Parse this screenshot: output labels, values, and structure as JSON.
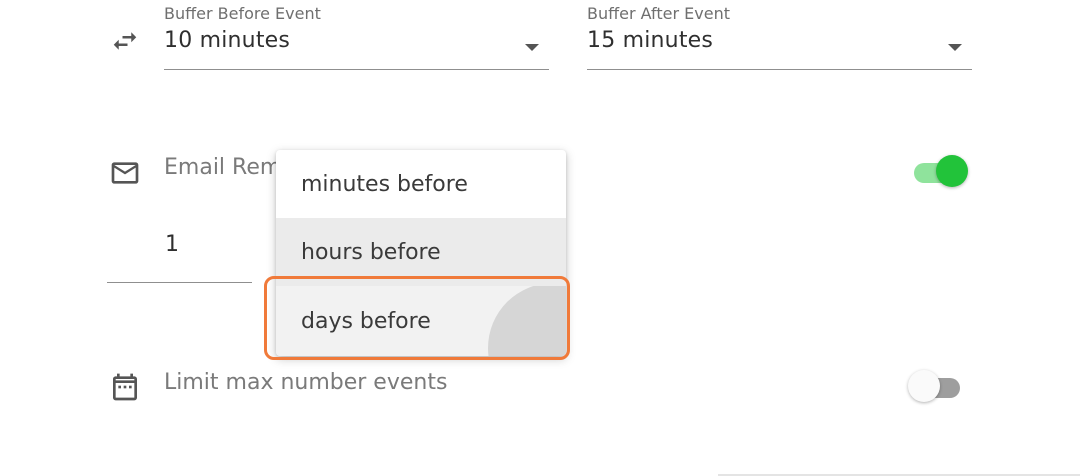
{
  "buffer": {
    "icon": "swap-horiz-icon",
    "before": {
      "label": "Buffer Before Event",
      "value": "10 minutes"
    },
    "after": {
      "label": "Buffer After Event",
      "value": "15 minutes"
    }
  },
  "email_reminder": {
    "icon": "mail-icon",
    "label": "Email Rem",
    "enabled": true,
    "amount": "1",
    "unit_menu": {
      "options": [
        "minutes before",
        "hours before",
        "days before"
      ],
      "hovered_index": 1,
      "pressed_index": 2
    }
  },
  "limit_events": {
    "icon": "calendar-icon",
    "label": "Limit max number events",
    "enabled": false
  },
  "colors": {
    "toggle_on_thumb": "#22c33a",
    "toggle_on_track": "#8fe39c",
    "toggle_off_track": "#9e9e9e",
    "highlight_outline": "#f07a3a"
  }
}
